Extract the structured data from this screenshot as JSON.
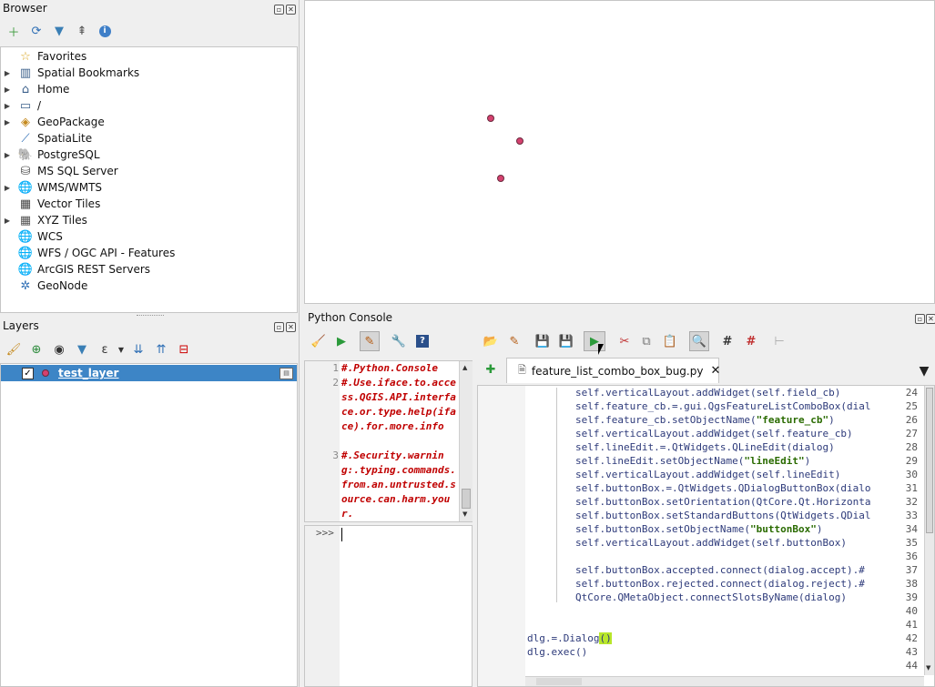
{
  "browser": {
    "title": "Browser",
    "items": [
      {
        "label": "Favorites",
        "icon": "star-icon",
        "expandable": false
      },
      {
        "label": "Spatial Bookmarks",
        "icon": "bookmarks-icon",
        "expandable": true
      },
      {
        "label": "Home",
        "icon": "home-folder-icon",
        "expandable": true
      },
      {
        "label": "/",
        "icon": "folder-icon",
        "expandable": true
      },
      {
        "label": "GeoPackage",
        "icon": "geopackage-icon",
        "expandable": true
      },
      {
        "label": "SpatiaLite",
        "icon": "spatialite-icon",
        "expandable": false
      },
      {
        "label": "PostgreSQL",
        "icon": "postgresql-icon",
        "expandable": true
      },
      {
        "label": "MS SQL Server",
        "icon": "mssql-icon",
        "expandable": false
      },
      {
        "label": "WMS/WMTS",
        "icon": "wms-globe-icon",
        "expandable": true
      },
      {
        "label": "Vector Tiles",
        "icon": "vector-tiles-icon",
        "expandable": false
      },
      {
        "label": "XYZ Tiles",
        "icon": "xyz-tiles-icon",
        "expandable": true
      },
      {
        "label": "WCS",
        "icon": "wcs-globe-icon",
        "expandable": false
      },
      {
        "label": "WFS / OGC API - Features",
        "icon": "wfs-globe-icon",
        "expandable": false
      },
      {
        "label": "ArcGIS REST Servers",
        "icon": "arcgis-globe-icon",
        "expandable": false
      },
      {
        "label": "GeoNode",
        "icon": "geonode-icon",
        "expandable": false
      }
    ]
  },
  "layers": {
    "title": "Layers",
    "items": [
      {
        "label": "test_layer",
        "checked": true,
        "selected": true
      }
    ]
  },
  "console": {
    "title": "Python Console",
    "output_lines": [
      {
        "num": "1",
        "text": "#.Python.Console"
      },
      {
        "num": "2",
        "text": "#.Use.iface.to.access.QGIS.API.interface.or.type.help(iface).for.more.info"
      },
      {
        "num": "3",
        "text": "#.Security.warning:.typing.commands.from.an.untrusted.source.can.harm.your."
      }
    ],
    "prompt": ">>>",
    "tab_label": "feature_list_combo_box_bug.py"
  },
  "editor": {
    "lines": [
      {
        "num": "24",
        "text": "        self.verticalLayout.addWidget(self.field_cb)"
      },
      {
        "num": "25",
        "text": "        self.feature_cb.=.gui.QgsFeatureListComboBox(dial"
      },
      {
        "num": "26",
        "pre": "        self.feature_cb.setObjectName(",
        "str": "\"feature_cb\"",
        "post": ")"
      },
      {
        "num": "27",
        "text": "        self.verticalLayout.addWidget(self.feature_cb)"
      },
      {
        "num": "28",
        "text": "        self.lineEdit.=.QtWidgets.QLineEdit(dialog)"
      },
      {
        "num": "29",
        "pre": "        self.lineEdit.setObjectName(",
        "str": "\"lineEdit\"",
        "post": ")"
      },
      {
        "num": "30",
        "text": "        self.verticalLayout.addWidget(self.lineEdit)"
      },
      {
        "num": "31",
        "text": "        self.buttonBox.=.QtWidgets.QDialogButtonBox(dialo"
      },
      {
        "num": "32",
        "text": "        self.buttonBox.setOrientation(QtCore.Qt.Horizonta"
      },
      {
        "num": "33",
        "text": "        self.buttonBox.setStandardButtons(QtWidgets.QDial"
      },
      {
        "num": "34",
        "pre": "        self.buttonBox.setObjectName(",
        "str": "\"buttonBox\"",
        "post": ")"
      },
      {
        "num": "35",
        "text": "        self.verticalLayout.addWidget(self.buttonBox)"
      },
      {
        "num": "36",
        "text": ""
      },
      {
        "num": "37",
        "text": "        self.buttonBox.accepted.connect(dialog.accept).#"
      },
      {
        "num": "38",
        "text": "        self.buttonBox.rejected.connect(dialog.reject).#"
      },
      {
        "num": "39",
        "text": "        QtCore.QMetaObject.connectSlotsByName(dialog)"
      },
      {
        "num": "40",
        "text": ""
      },
      {
        "num": "41",
        "text": ""
      },
      {
        "num": "42",
        "pre": "dlg.=.Dialog",
        "hl": "()",
        "post": ""
      },
      {
        "num": "43",
        "text": "dlg.exec()"
      },
      {
        "num": "44",
        "text": ""
      }
    ]
  },
  "map": {
    "point_color": "#d5416f",
    "points": [
      {
        "x": 0.295,
        "y": 0.385
      },
      {
        "x": 0.34,
        "y": 0.462
      },
      {
        "x": 0.31,
        "y": 0.585
      }
    ]
  },
  "colors": {
    "selection": "#3d85c6",
    "error_text": "#c00000",
    "string_literal": "#2a6b00",
    "highlight": "#b8e62a"
  }
}
